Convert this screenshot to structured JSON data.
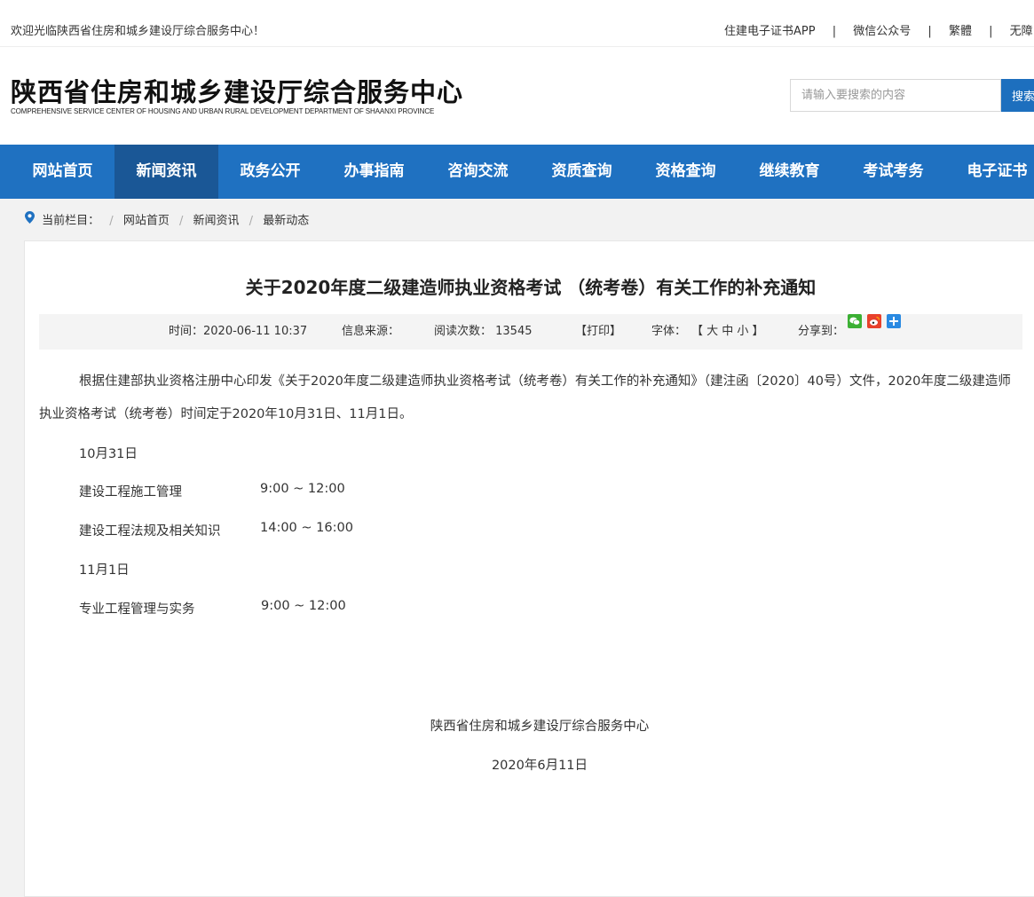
{
  "topbar": {
    "welcome": "欢迎光临陕西省住房和城乡建设厅综合服务中心！",
    "links": [
      "住建电子证书APP",
      "微信公众号",
      "繁體",
      "无障"
    ]
  },
  "header": {
    "title": "陕西省住房和城乡建设厅综合服务中心",
    "subtitle": "COMPREHENSIVE SERVICE CENTER OF HOUSING AND URBAN RURAL DEVELOPMENT DEPARTMENT OF SHAANXI PROVINCE",
    "search_placeholder": "请输入要搜索的内容",
    "search_button": "搜索"
  },
  "nav": {
    "items": [
      "网站首页",
      "新闻资讯",
      "政务公开",
      "办事指南",
      "咨询交流",
      "资质查询",
      "资格查询",
      "继续教育",
      "考试考务",
      "电子证书"
    ],
    "active_index": 1
  },
  "breadcrumb": {
    "label": "当前栏目：",
    "items": [
      "网站首页",
      "新闻资讯",
      "最新动态"
    ]
  },
  "article": {
    "title": "关于2020年度二级建造师执业资格考试 （统考卷）有关工作的补充通知",
    "meta": {
      "time": "时间：2020-06-11 10:37",
      "source": "信息来源：",
      "reads": "阅读次数：  13545",
      "print": "【打印】",
      "font_label": "字体：",
      "font_sizes": "【 大  中  小 】",
      "share_label": "分享到："
    },
    "paragraph": "根据住建部执业资格注册中心印发《关于2020年度二级建造师执业资格考试（统考卷）有关工作的补充通知》（建注函〔2020〕40号）文件，2020年度二级建造师执业资格考试（统考卷）时间定于2020年10月31日、11月1日。",
    "day1": "10月31日",
    "day1_exams": [
      {
        "subject": "建设工程施工管理",
        "time": "9:00 ~ 12:00"
      },
      {
        "subject": "建设工程法规及相关知识",
        "time": "14:00 ~ 16:00"
      }
    ],
    "day2": "11月1日",
    "day2_exams": [
      {
        "subject": "专业工程管理与实务",
        "time": "9:00 ~ 12:00"
      }
    ],
    "signature": "陕西省住房和城乡建设厅综合服务中心",
    "date": "2020年6月11日"
  },
  "colors": {
    "nav_bg": "#1f71c1",
    "nav_active": "#1a5796",
    "search_button": "#1d6fbe"
  },
  "icons": [
    "location-pin-icon",
    "wechat-icon",
    "weibo-icon",
    "more-share-icon"
  ]
}
